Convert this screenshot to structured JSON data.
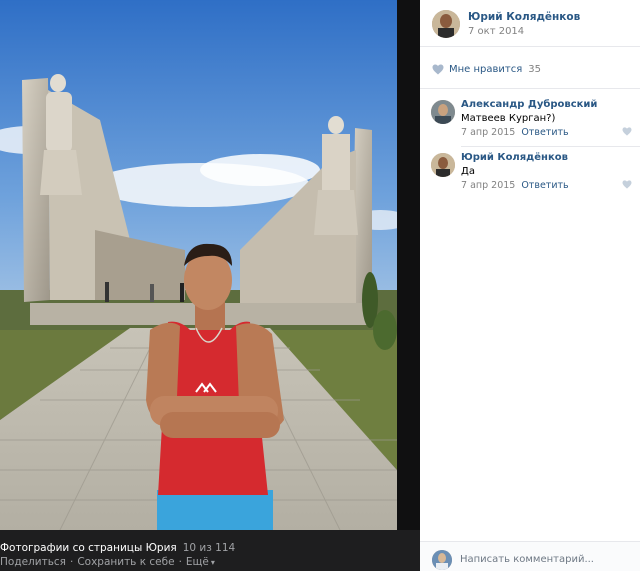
{
  "owner": {
    "name": "Юрий Колядёнков",
    "date": "7 окт 2014"
  },
  "likes": {
    "label": "Мне нравится",
    "count": "35",
    "icon": "heart-icon"
  },
  "comments": [
    {
      "author": "Александр Дубровский",
      "text": "Матвеев Курган?)",
      "date": "7 апр 2015",
      "reply_label": "Ответить"
    },
    {
      "author": "Юрий Колядёнков",
      "text": "Да",
      "date": "7 апр 2015",
      "reply_label": "Ответить"
    }
  ],
  "comment_box": {
    "placeholder": "Написать комментарий..."
  },
  "footer": {
    "album": "Фотографии со страницы Юрия",
    "counter": "10 из 114",
    "share": "Поделиться",
    "save": "Сохранить к себе",
    "more": "Ещё",
    "separator": "·"
  },
  "colors": {
    "link": "#2a5885",
    "muted": "#828282",
    "viewer_bg": "#1c1c1d",
    "sky": "#3f79c8"
  },
  "photo": {
    "subject": "man in red tank top in front of war memorial statues"
  }
}
